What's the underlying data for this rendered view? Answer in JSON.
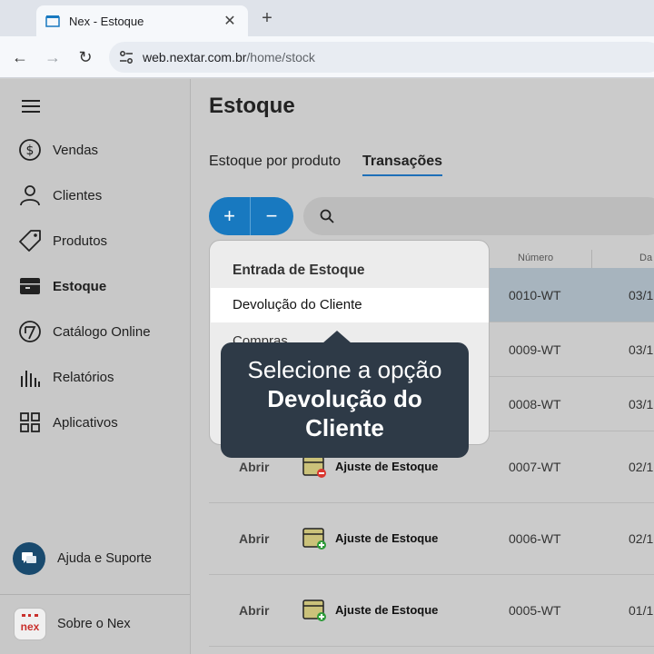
{
  "browser": {
    "tab_title": "Nex - Estoque",
    "url_domain": "web.nextar.com.br",
    "url_path": "/home/stock"
  },
  "sidebar": {
    "items": [
      {
        "label": "Vendas",
        "icon": "dollar-circle-icon"
      },
      {
        "label": "Clientes",
        "icon": "person-icon"
      },
      {
        "label": "Produtos",
        "icon": "tag-icon"
      },
      {
        "label": "Estoque",
        "icon": "box-icon"
      },
      {
        "label": "Catálogo Online",
        "icon": "catalog-icon"
      },
      {
        "label": "Relatórios",
        "icon": "bar-chart-icon"
      },
      {
        "label": "Aplicativos",
        "icon": "apps-grid-icon"
      }
    ],
    "help_label": "Ajuda e Suporte",
    "about_label": "Sobre o Nex",
    "logo_text": "nex"
  },
  "main": {
    "title": "Estoque",
    "tabs": [
      {
        "label": "Estoque por produto"
      },
      {
        "label": "Transações"
      }
    ],
    "columns": {
      "number": "Número",
      "date": "Da"
    },
    "rows": [
      {
        "number": "0010-WT",
        "date": "03/1"
      },
      {
        "number": "0009-WT",
        "date": "03/1"
      },
      {
        "number": "0008-WT",
        "date": "03/1"
      },
      {
        "open": "Abrir",
        "type": "Ajuste de Estoque",
        "number": "0007-WT",
        "date": "02/1"
      },
      {
        "open": "Abrir",
        "type": "Ajuste de Estoque",
        "number": "0006-WT",
        "date": "02/1"
      },
      {
        "open": "Abrir",
        "type": "Ajuste de Estoque",
        "number": "0005-WT",
        "date": "01/1"
      }
    ]
  },
  "menu": {
    "heading": "Entrada de Estoque",
    "items": [
      {
        "label": "Devolução do Cliente"
      },
      {
        "label": "Compras"
      }
    ]
  },
  "tooltip": {
    "line1": "Selecione a opção",
    "line2": "Devolução do",
    "line3": "Cliente"
  },
  "colors": {
    "accent": "#1879c0",
    "tooltip_bg": "#2e3a47",
    "negative_badge": "#d9362f",
    "positive_badge": "#2e9b3a"
  }
}
